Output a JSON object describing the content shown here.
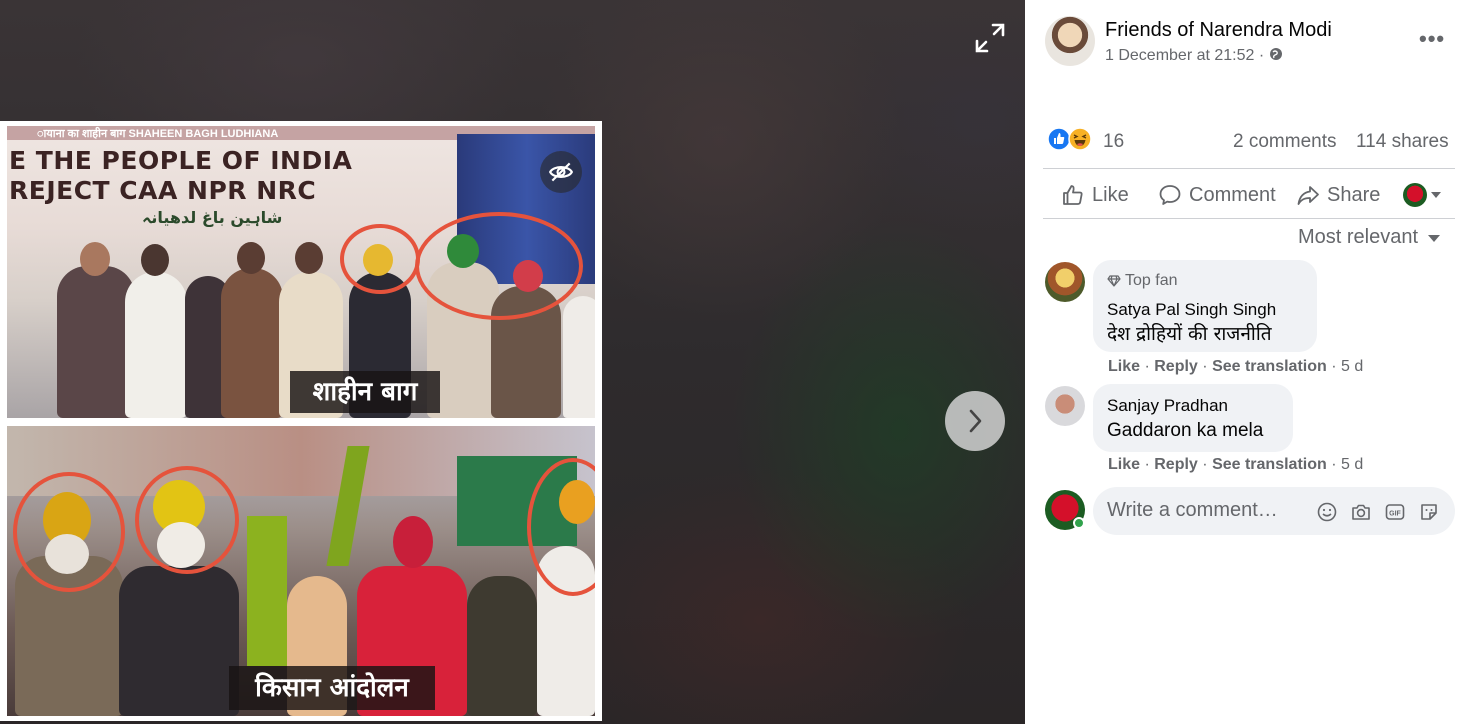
{
  "viewer": {
    "photo": {
      "top_banner_strip": "ायाना का शाहीन बाग  SHAHEEN BAGH LUDHIANA",
      "banner_line1": "E THE PEOPLE OF INDIA",
      "banner_line2": "REJECT CAA NPR NRC",
      "banner_urdu": "شاہین باغ لدھیانہ",
      "caption_top": "शाहीन बाग",
      "caption_bottom": "किसान आंदोलन"
    }
  },
  "post": {
    "page_name": "Friends of Narendra Modi",
    "timestamp": "1 December at 21:52 ·",
    "reaction_count": "16",
    "comments_count": "2 comments",
    "shares_count": "114 shares",
    "actions": {
      "like": "Like",
      "comment": "Comment",
      "share": "Share"
    },
    "sort_label": "Most relevant"
  },
  "comments": [
    {
      "badge": "Top fan",
      "author": "Satya Pal Singh Singh",
      "text": "देश द्रोहियों की राजनीति",
      "like": "Like",
      "reply": "Reply",
      "translate": "See translation",
      "age": "5 d"
    },
    {
      "author": "Sanjay Pradhan",
      "text": "Gaddaron ka mela",
      "like": "Like",
      "reply": "Reply",
      "translate": "See translation",
      "age": "5 d"
    }
  ],
  "composer": {
    "placeholder": "Write a comment…"
  },
  "colors": {
    "accent": "#1877f2",
    "circle": "#e5533c",
    "sidebar_bg": "#ffffff"
  }
}
